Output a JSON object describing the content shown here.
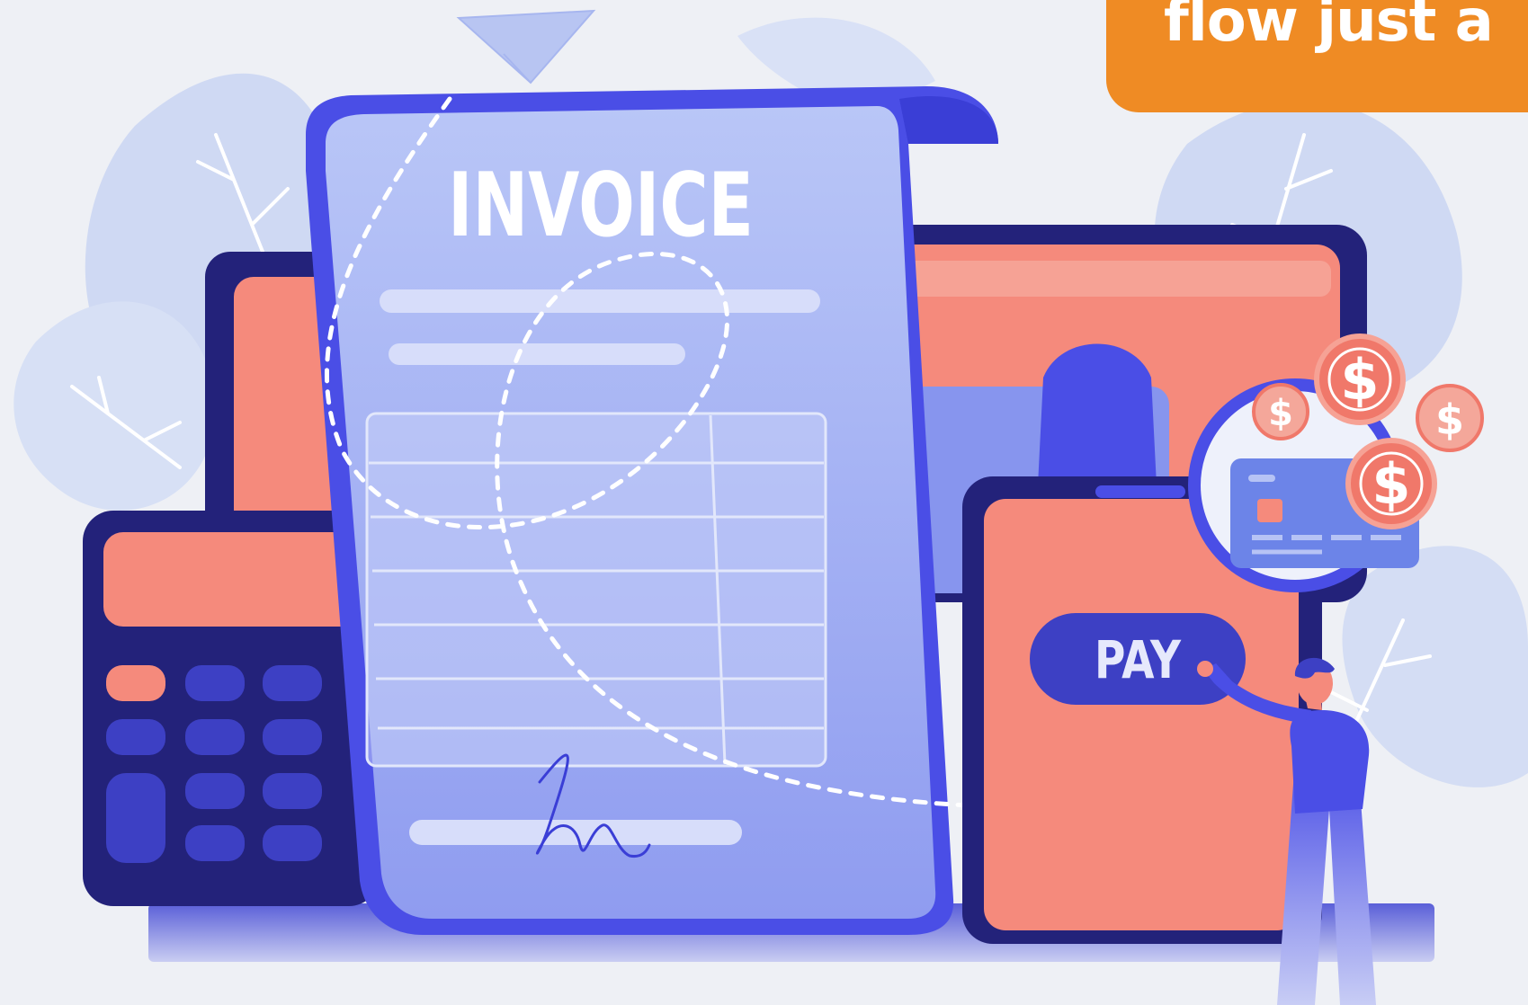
{
  "banner": {
    "text": "flow just a",
    "color": "#ef8b24"
  },
  "invoice": {
    "title": "INVOICE"
  },
  "phone": {
    "pay_label": "PAY"
  },
  "coins": {
    "symbol": "$"
  },
  "colors": {
    "background": "#eef0f5",
    "foliage": "#cfd9f3",
    "paper": "#a9b9f5",
    "navy": "#23227a",
    "indigo": "#4a4ee6",
    "coral": "#f58a7c",
    "coin": "#f0786a"
  }
}
